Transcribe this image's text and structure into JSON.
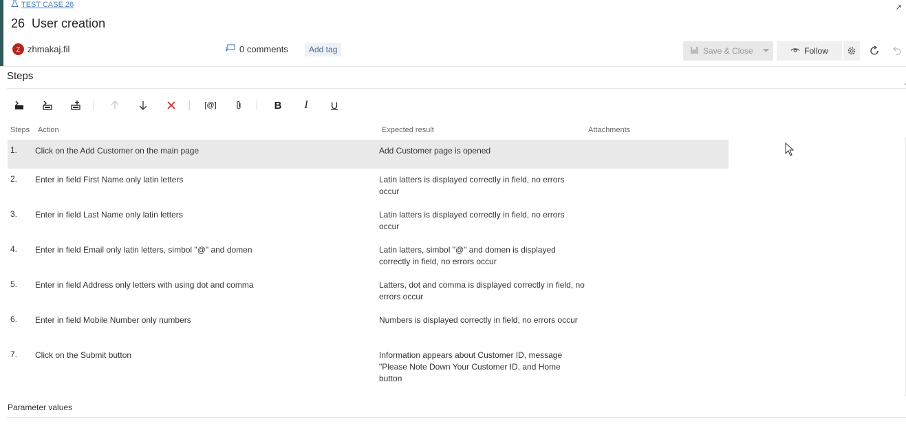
{
  "work_item": {
    "type_label": "TEST CASE 26",
    "id": "26",
    "title": "User creation",
    "user": "zhmakaj.fil",
    "avatar_initial": "Z",
    "comments": "0 comments",
    "add_tag": "Add tag"
  },
  "toolbar": {
    "save_close": "Save & Close",
    "follow": "Follow"
  },
  "steps": {
    "title": "Steps",
    "columns": {
      "steps": "Steps",
      "action": "Action",
      "expected": "Expected result",
      "attachments": "Attachments"
    },
    "rows": [
      {
        "num": "1.",
        "action": "Click on the Add Customer on the main page",
        "expected": "Add Customer page is opened"
      },
      {
        "num": "2.",
        "action": "Enter in field First Name only latin letters",
        "expected": "Latin latters is displayed correctly in field, no errors occur"
      },
      {
        "num": "3.",
        "action": "Enter in field Last Name only latin letters",
        "expected": "Latin latters is displayed correctly in field, no errors occur"
      },
      {
        "num": "4.",
        "action": "Enter in field Email only latin letters, simbol \"@\" and domen",
        "expected": "Latin latters, simbol \"@\" and domen is displayed correctly in field, no errors occur"
      },
      {
        "num": "5.",
        "action": "Enter in field Address only letters with using dot and comma",
        "expected": "Latters, dot and comma is displayed correctly in field, no errors occur"
      },
      {
        "num": "6.",
        "action": "Enter in field Mobile Number only numbers",
        "expected": "Numbers is displayed correctly in field, no errors occur"
      },
      {
        "num": "7.",
        "action": "Click on the Submit button",
        "expected": "Information appears about Customer ID, message \"Please Note Down Your Customer ID, and Home button"
      }
    ]
  },
  "parameters": {
    "title": "Parameter values"
  },
  "colors": {
    "accent": "#2e5b59",
    "avatar": "#b3261e",
    "delete": "#d32f2f",
    "link": "#4a7fb5"
  },
  "icons": [
    "flask-icon",
    "expand-icon",
    "comment-icon",
    "save-icon",
    "eye-icon",
    "gear-icon",
    "refresh-icon",
    "undo-icon",
    "insert-step-icon",
    "insert-shared-step-icon",
    "create-shared-step-icon",
    "move-up-icon",
    "move-down-icon",
    "delete-icon",
    "parameter-icon",
    "attachment-icon",
    "bold-icon",
    "italic-icon",
    "underline-icon",
    "cursor-icon"
  ]
}
